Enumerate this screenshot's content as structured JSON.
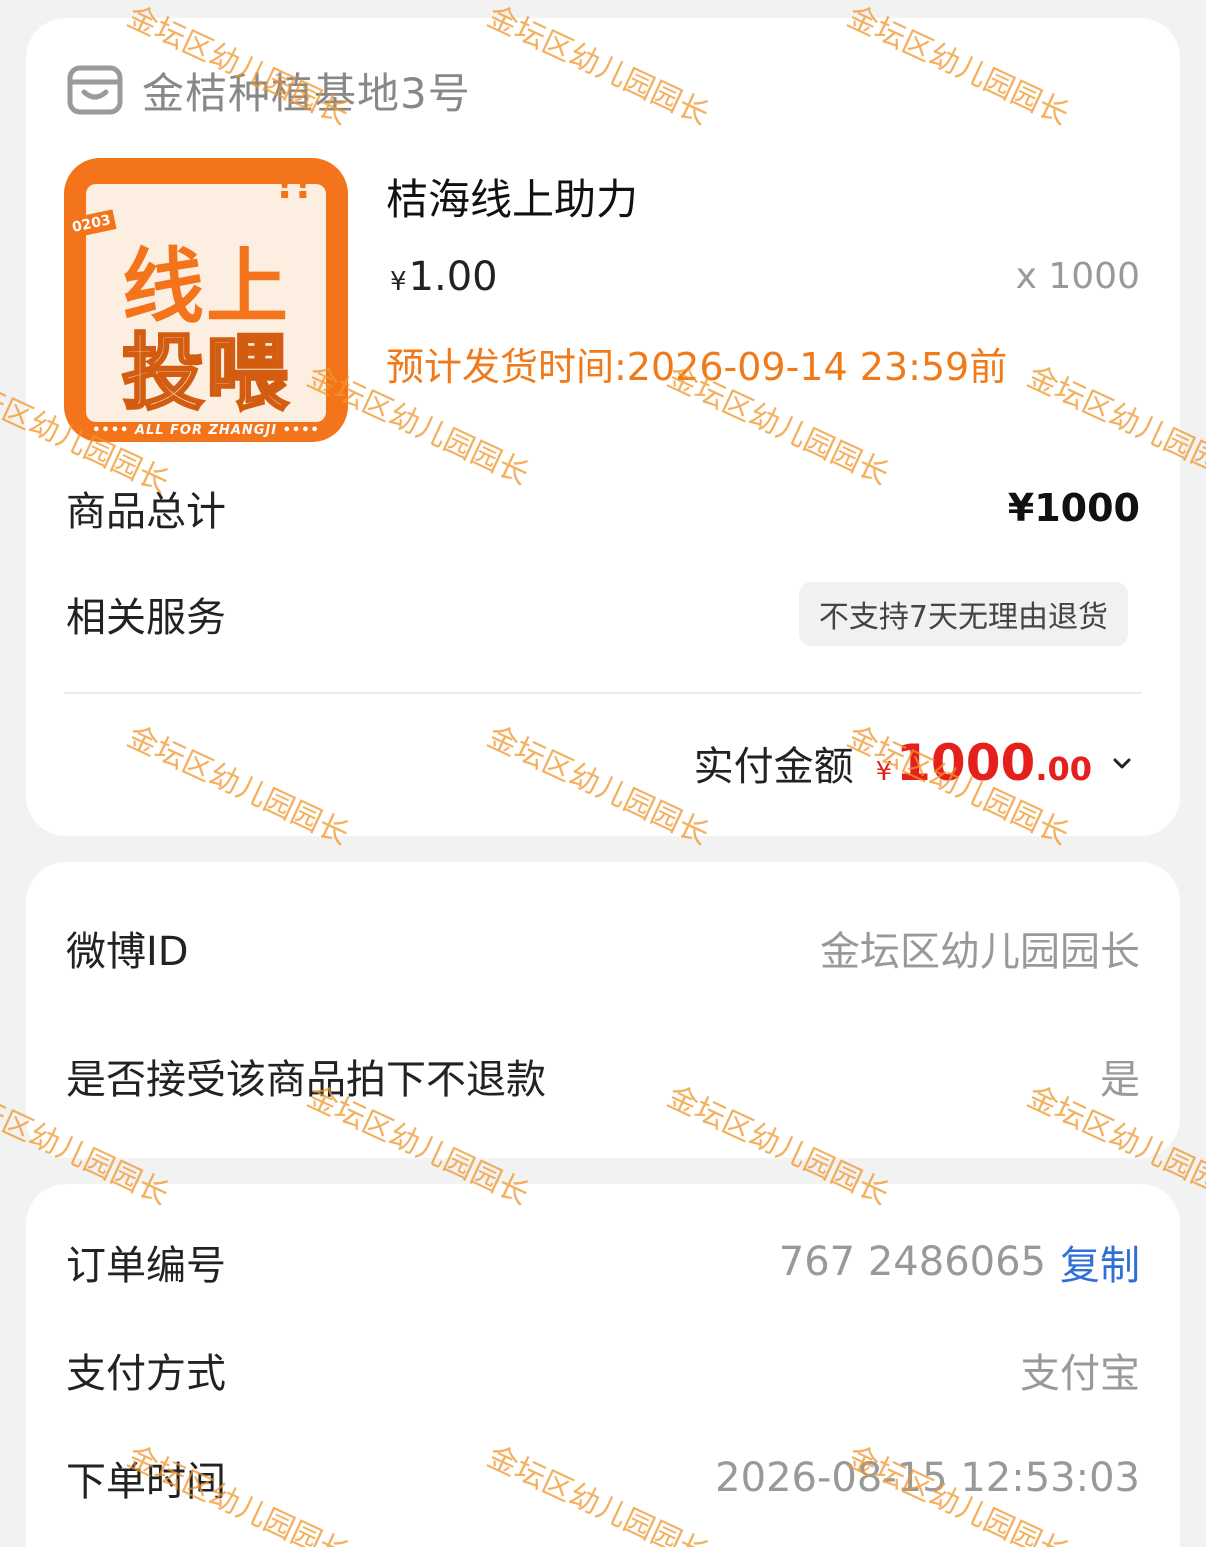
{
  "shop": {
    "name": "金桔种植基地3号",
    "icon": "shop-icon"
  },
  "product": {
    "thumb_line1": "线上",
    "thumb_line2": "投喂",
    "thumb_badge": "0203",
    "thumb_excl": "!!",
    "thumb_footer": "•••• ALL FOR ZHANGJI ••••",
    "title": "桔海线上助力",
    "price_symbol": "¥",
    "price": "1.00",
    "qty": "x 1000",
    "ship_time": "预计发货时间:2026-09-14 23:59前"
  },
  "summary": {
    "total_label": "商品总计",
    "total_value": "¥1000",
    "service_label": "相关服务",
    "service_tag": "不支持7天无理由退货",
    "paid_label": "实付金额",
    "paid_symbol": "¥",
    "paid_int": "1000",
    "paid_dec": ".00"
  },
  "info": {
    "weibo_label": "微博ID",
    "weibo_value": "金坛区幼儿园园长",
    "refund_label": "是否接受该商品拍下不退款",
    "refund_value": "是"
  },
  "meta": {
    "order_label": "订单编号",
    "order_value": "767 2486065",
    "copy_label": "复制",
    "pay_label": "支付方式",
    "pay_value": "支付宝",
    "time_label": "下单时间",
    "time_value": "2026-08-15 12:53:03"
  },
  "watermark": "金坛区幼儿园园长",
  "colors": {
    "accent_orange": "#f07a1a",
    "price_red": "#e5201c",
    "link_blue": "#2f6fd6"
  }
}
